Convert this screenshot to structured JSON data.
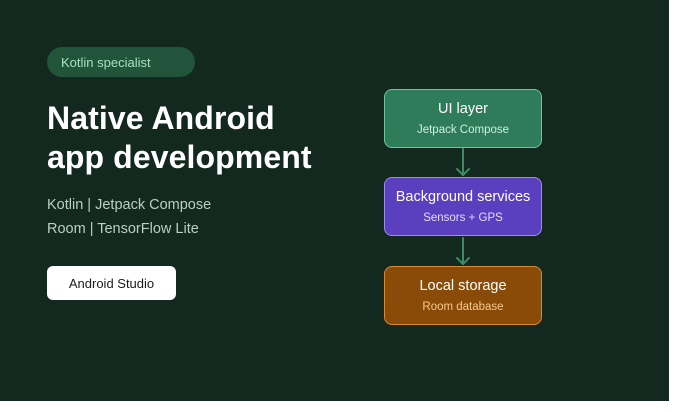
{
  "tag": "Kotlin specialist",
  "headline": {
    "line1": "Native Android",
    "line2": "app development"
  },
  "stack": {
    "line1": "Kotlin | Jetpack Compose",
    "line2": "Room | TensorFlow Lite"
  },
  "cta_label": "Android Studio",
  "diagram": {
    "boxes": [
      {
        "title": "UI layer",
        "subtitle": "Jetpack Compose"
      },
      {
        "title": "Background services",
        "subtitle": "Sensors + GPS"
      },
      {
        "title": "Local storage",
        "subtitle": "Room database"
      }
    ]
  },
  "colors": {
    "background": "#13281e",
    "tag_bg": "#21543a",
    "ui_box": "#2f7c5a",
    "services_box": "#5a3fbf",
    "storage_box": "#8a4a08",
    "connector": "#3f8a62"
  }
}
